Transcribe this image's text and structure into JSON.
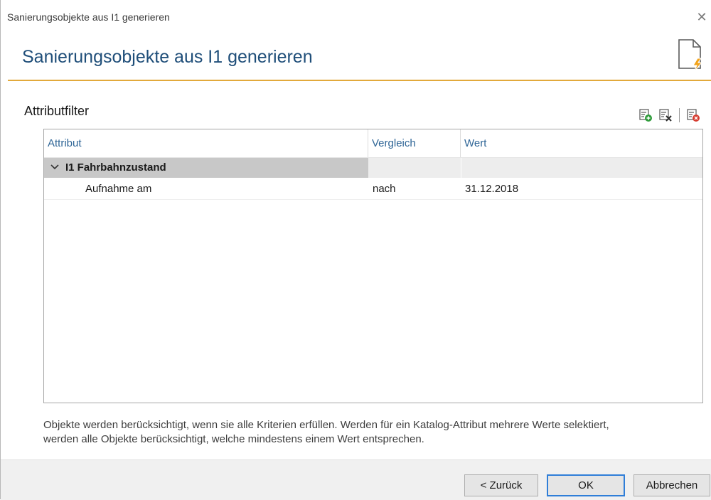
{
  "window": {
    "title": "Sanierungsobjekte aus I1 generieren",
    "close_glyph": "✕"
  },
  "header": {
    "heading": "Sanierungsobjekte aus I1 generieren",
    "icon": "document-lightning-icon"
  },
  "section": {
    "title": "Attributfilter"
  },
  "toolbar": {
    "buttons": [
      {
        "icon": "add-filter-icon",
        "color": "#2e9b3a"
      },
      {
        "icon": "remove-filter-icon",
        "color": "#2b2b2b"
      },
      {
        "icon": "delete-all-filters-icon",
        "color": "#d63b2f"
      }
    ]
  },
  "grid": {
    "columns": [
      "Attribut",
      "Vergleich",
      "Wert"
    ],
    "group": {
      "label": "I1 Fahrbahnzustand",
      "expanded": true
    },
    "rows": [
      {
        "attribut": "Aufnahme am",
        "vergleich": "nach",
        "wert": "31.12.2018"
      }
    ]
  },
  "info": {
    "line1": "Objekte werden berücksichtigt, wenn sie alle Kriterien erfüllen. Werden für ein Katalog-Attribut mehrere Werte selektiert,",
    "line2": "werden alle Objekte berücksichtigt, welche mindestens einem Wert entsprechen."
  },
  "footer": {
    "back_label": "< Zurück",
    "ok_label": "OK",
    "cancel_label": "Abbrechen"
  },
  "colors": {
    "accent_rule": "#e2a93b",
    "heading": "#1f4e79",
    "column_header": "#2e6596",
    "default_button_border": "#2f7ed8"
  }
}
